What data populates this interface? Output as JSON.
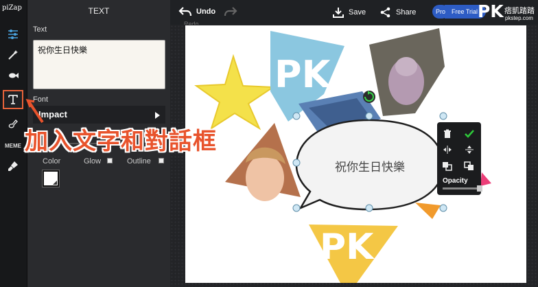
{
  "app": {
    "logo": "piZap"
  },
  "panel": {
    "title": "TEXT",
    "text_label": "Text",
    "text_value": "祝你生日快樂",
    "font_label": "Font",
    "font_value": "Impact",
    "options": {
      "color": "Color",
      "glow": "Glow",
      "outline": "Outline"
    }
  },
  "rail": {
    "items": [
      {
        "name": "adjust",
        "icon": "sliders-icon"
      },
      {
        "name": "effects",
        "icon": "magic-wand-icon"
      },
      {
        "name": "stickers",
        "icon": "fish-icon"
      },
      {
        "name": "text",
        "icon": "text-icon",
        "active": true
      },
      {
        "name": "paint",
        "icon": "paint-icon"
      },
      {
        "name": "meme",
        "label": "MEME"
      },
      {
        "name": "touch-up",
        "icon": "brush-icon"
      }
    ]
  },
  "topbar": {
    "undo_label": "Undo",
    "redo_label": "Redo",
    "save_label": "Save",
    "share_label": "Share",
    "pro_label": "Pro",
    "free_trial_label": "Free Trial"
  },
  "watermark": {
    "brand": "PK",
    "chinese": "痞凱踏踏",
    "url": "pkstep.com"
  },
  "canvas": {
    "speech_bubble_text": "祝你生日快樂"
  },
  "toolbox": {
    "opacity_label": "Opacity",
    "opacity_value": 1.0
  },
  "annotation": {
    "text": "加入文字和對話框"
  },
  "colors": {
    "accent": "#e8633a",
    "confirm": "#2ec83a",
    "pro_badge": "#2d5cc4",
    "panel_bg": "#2a2b2e"
  }
}
